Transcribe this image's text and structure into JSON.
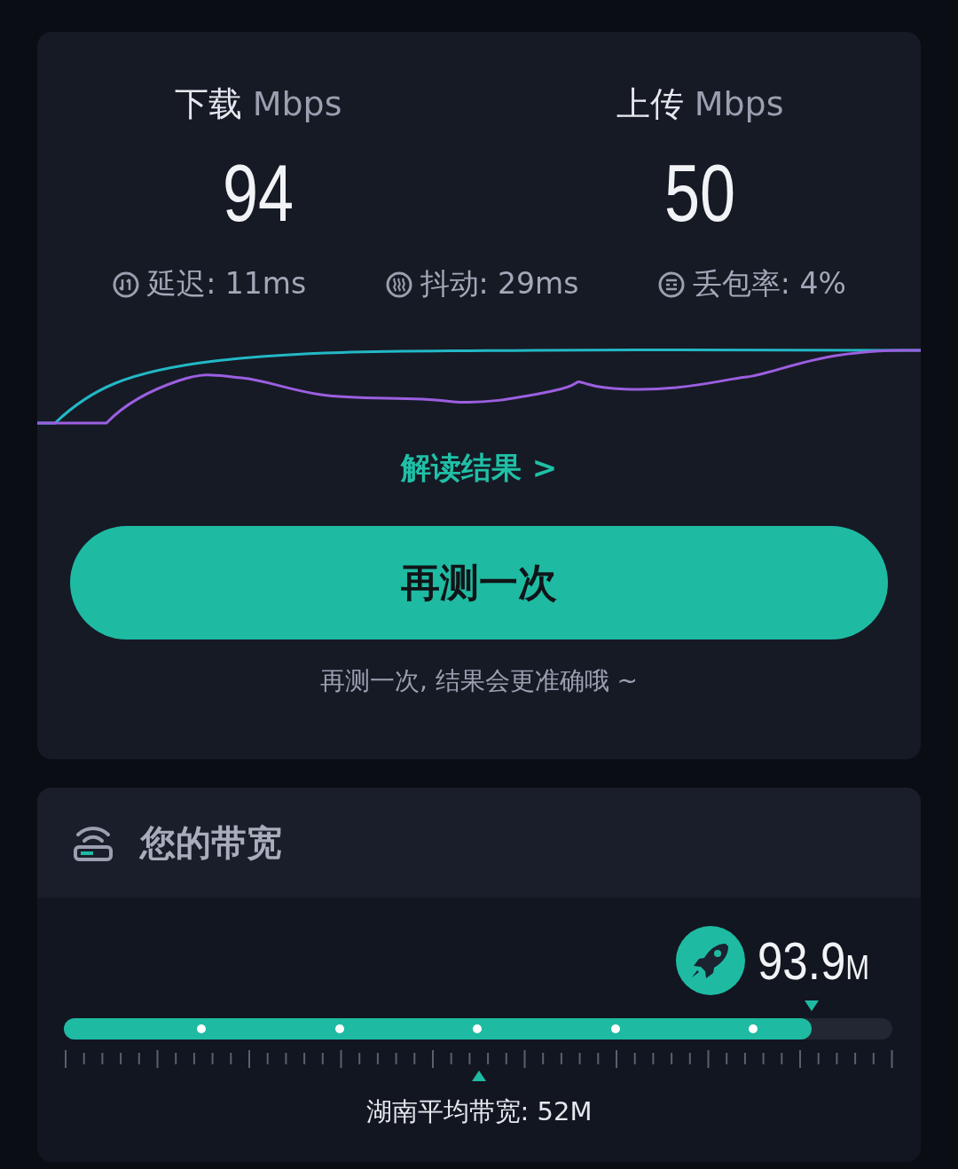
{
  "result": {
    "speeds": [
      {
        "label": "下载",
        "unit": "Mbps",
        "value": "94"
      },
      {
        "label": "上传",
        "unit": "Mbps",
        "value": "50"
      }
    ],
    "metrics": [
      {
        "kind": "latency",
        "text": "延迟: 11ms"
      },
      {
        "kind": "jitter",
        "text": "抖动: 29ms"
      },
      {
        "kind": "loss",
        "text": "丢包率: 4%"
      }
    ],
    "link": "解读结果 >",
    "button": "再测一次",
    "hint": "再测一次, 结果会更准确哦 ~"
  },
  "bandwidth": {
    "title": "您的带宽",
    "value": "93.9",
    "unit": "M",
    "level": 0.903,
    "average": "湖南平均带宽: 52M"
  }
}
